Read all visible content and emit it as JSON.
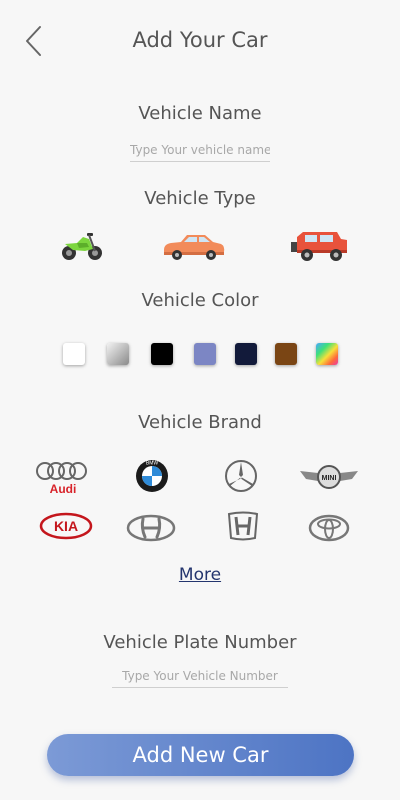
{
  "header": {
    "title": "Add Your Car",
    "back_icon": "chevron-left-icon"
  },
  "vehicle_name": {
    "label": "Vehicle Name",
    "placeholder": "Type Your vehicle name",
    "value": ""
  },
  "vehicle_type": {
    "label": "Vehicle Type",
    "options": [
      {
        "name": "motorcycle",
        "icon": "motorbike-icon",
        "color": "#7cd63e"
      },
      {
        "name": "sedan",
        "icon": "sedan-car-icon",
        "color": "#f28b5a"
      },
      {
        "name": "suv",
        "icon": "suv-icon",
        "color": "#e8533c"
      }
    ]
  },
  "vehicle_color": {
    "label": "Vehicle Color",
    "colors": [
      "#ffffff",
      "silver-gradient",
      "#000000",
      "#7c86c4",
      "#121a3a",
      "#7a4514",
      "rainbow-gradient"
    ]
  },
  "vehicle_brand": {
    "label": "Vehicle Brand",
    "brands": [
      {
        "name": "Audi",
        "logo_text": "Audi"
      },
      {
        "name": "BMW",
        "logo_text": "BMW"
      },
      {
        "name": "Mercedes-Benz",
        "logo_text": ""
      },
      {
        "name": "MINI",
        "logo_text": "MINI"
      },
      {
        "name": "KIA",
        "logo_text": "KIA"
      },
      {
        "name": "Hyundai",
        "logo_text": ""
      },
      {
        "name": "Honda",
        "logo_text": ""
      },
      {
        "name": "Toyota",
        "logo_text": ""
      }
    ],
    "more_label": "More"
  },
  "plate_number": {
    "label": "Vehicle Plate Number",
    "placeholder": "Type Your Vehicle Number",
    "value": ""
  },
  "submit": {
    "label": "Add New Car"
  },
  "colors": {
    "accent_start": "#7c9ad6",
    "accent_end": "#4d74c4",
    "link": "#24356e"
  }
}
